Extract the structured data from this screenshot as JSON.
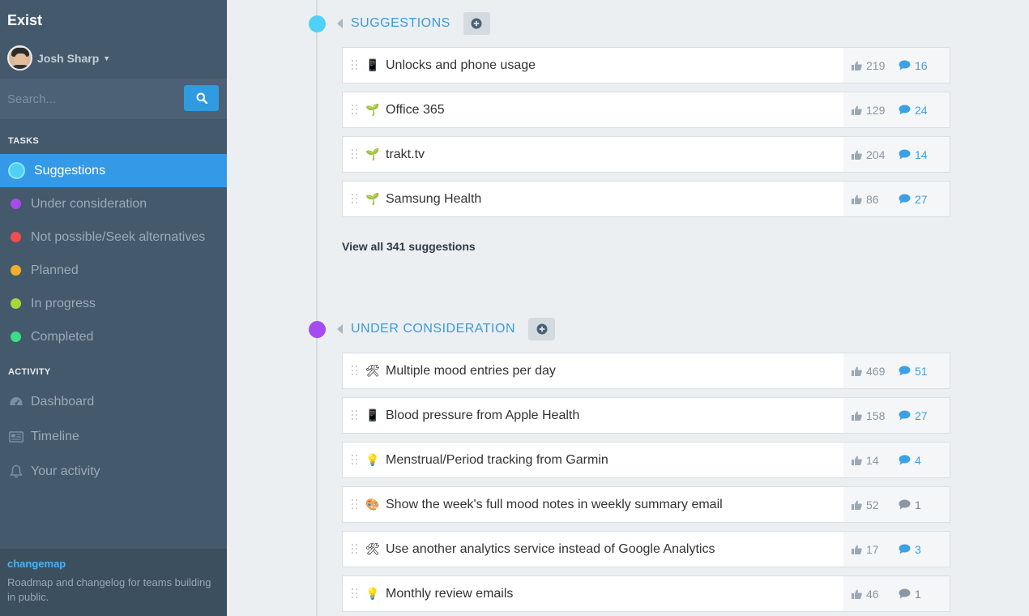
{
  "app": {
    "title": "Exist"
  },
  "user": {
    "name": "Josh Sharp"
  },
  "search": {
    "placeholder": "Search..."
  },
  "sidebar": {
    "tasks_label": "TASKS",
    "tasks": [
      {
        "label": "Suggestions",
        "color": "#4fd0f5"
      },
      {
        "label": "Under consideration",
        "color": "#a64bf0"
      },
      {
        "label": "Not possible/Seek alternatives",
        "color": "#f24d4d"
      },
      {
        "label": "Planned",
        "color": "#f5b027"
      },
      {
        "label": "In progress",
        "color": "#a8d53a"
      },
      {
        "label": "Completed",
        "color": "#3ddc86"
      }
    ],
    "activity_label": "ACTIVITY",
    "activity": [
      {
        "label": "Dashboard",
        "icon": "dashboard-icon"
      },
      {
        "label": "Timeline",
        "icon": "newspaper-icon"
      },
      {
        "label": "Your activity",
        "icon": "bell-icon"
      }
    ],
    "footer": {
      "brand": "changemap",
      "description": "Roadmap and changelog for teams building in public."
    }
  },
  "sections": [
    {
      "title": "SUGGESTIONS",
      "color": "#4fd0f5",
      "items": [
        {
          "emoji": "📱",
          "title": "Unlocks and phone usage",
          "votes": "219",
          "comments": "16"
        },
        {
          "emoji": "🌱",
          "title": "Office 365",
          "votes": "129",
          "comments": "24"
        },
        {
          "emoji": "🌱",
          "title": "trakt.tv",
          "votes": "204",
          "comments": "14"
        },
        {
          "emoji": "🌱",
          "title": "Samsung Health",
          "votes": "86",
          "comments": "27"
        }
      ],
      "view_all": "View all 341 suggestions"
    },
    {
      "title": "UNDER CONSIDERATION",
      "color": "#a64bf0",
      "items": [
        {
          "emoji": "🛠",
          "title": "Multiple mood entries per day",
          "votes": "469",
          "comments": "51"
        },
        {
          "emoji": "📱",
          "title": "Blood pressure from Apple Health",
          "votes": "158",
          "comments": "27"
        },
        {
          "emoji": "💡",
          "title": "Menstrual/Period tracking from Garmin",
          "votes": "14",
          "comments": "4"
        },
        {
          "emoji": "🎨",
          "title": "Show the week's full mood notes in weekly summary email",
          "votes": "52",
          "comments": "1"
        },
        {
          "emoji": "🛠",
          "title": "Use another analytics service instead of Google Analytics",
          "votes": "17",
          "comments": "3"
        },
        {
          "emoji": "💡",
          "title": "Monthly review emails",
          "votes": "46",
          "comments": "1"
        }
      ]
    }
  ]
}
